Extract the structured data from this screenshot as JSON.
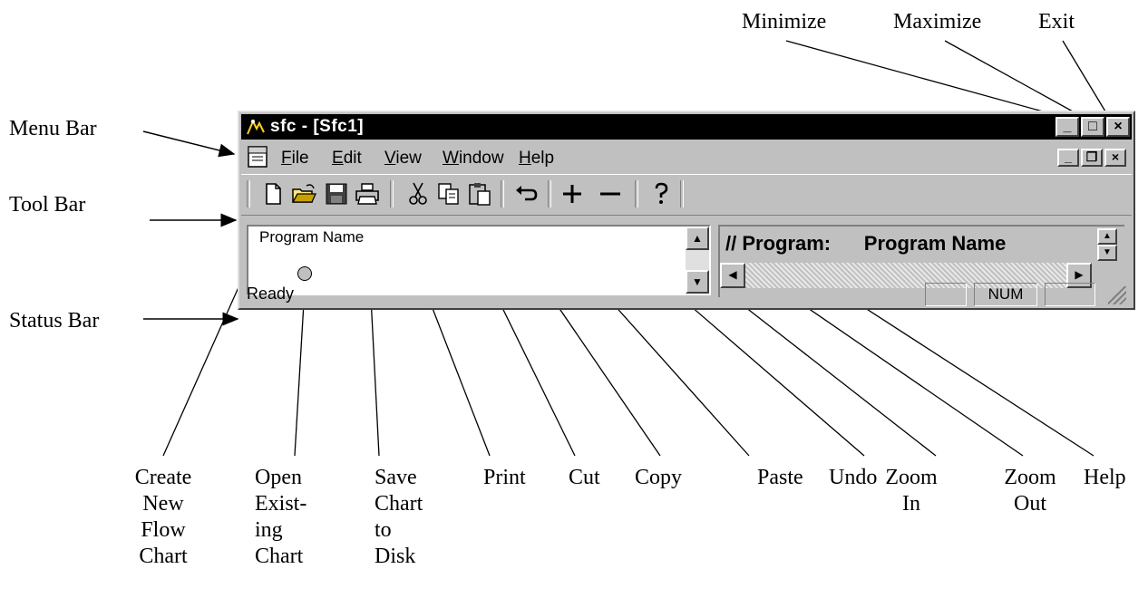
{
  "window": {
    "title": "sfc - [Sfc1]",
    "menu": [
      "File",
      "Edit",
      "View",
      "Window",
      "Help"
    ],
    "menu_accel": [
      "F",
      "E",
      "V",
      "W",
      "H"
    ],
    "left_pane": {
      "program_name": "Program Name"
    },
    "right_pane": {
      "code": "// Program:      Program Name"
    },
    "status": {
      "text": "Ready",
      "indicators": [
        "",
        "NUM",
        ""
      ]
    }
  },
  "callouts": {
    "top": {
      "minimize": "Minimize",
      "maximize": "Maximize",
      "exit": "Exit"
    },
    "left": {
      "menu_bar": "Menu Bar",
      "tool_bar": "Tool Bar",
      "status_bar": "Status Bar"
    },
    "bottom": [
      "Create\nNew\nFlow\nChart",
      "Open\nExist-\ning\nChart",
      "Save\nChart\nto\nDisk",
      "Print",
      "Cut",
      "Copy",
      "Paste",
      "Undo",
      "Zoom\nIn",
      "Zoom\nOut",
      "Help"
    ]
  },
  "icons": {
    "toolbar": [
      "new-file-icon",
      "open-folder-icon",
      "save-disk-icon",
      "print-icon",
      "cut-icon",
      "copy-icon",
      "paste-icon",
      "undo-icon",
      "zoom-in-icon",
      "zoom-out-icon",
      "help-icon"
    ],
    "window": [
      "app-icon",
      "document-icon",
      "minimize-icon",
      "maximize-icon",
      "close-icon"
    ]
  }
}
